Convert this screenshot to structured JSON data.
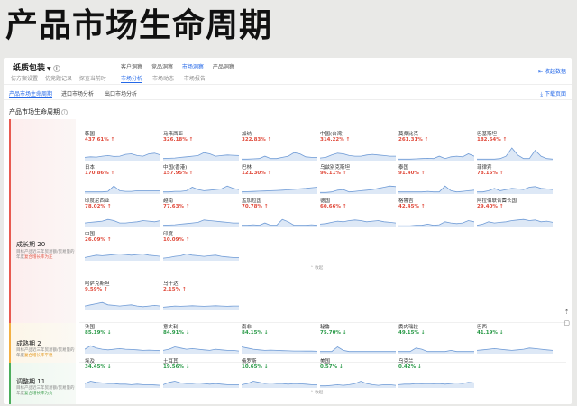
{
  "page_title": "产品市场生命周期",
  "header": {
    "product": "纸质包装",
    "sub_links": [
      "仿方案设置",
      "仿竞题记录",
      "探查当前时"
    ],
    "tabs_top": [
      {
        "label": "客户洞察",
        "active": false
      },
      {
        "label": "竞品洞察",
        "active": false
      },
      {
        "label": "市场洞察",
        "active": true
      },
      {
        "label": "产品洞察",
        "active": false
      }
    ],
    "tabs_sub": [
      {
        "label": "市场分析",
        "active": true
      },
      {
        "label": "市场动态",
        "active": false
      },
      {
        "label": "市场报告",
        "active": false
      }
    ],
    "collapse_label": "收起数据"
  },
  "tabs": [
    {
      "label": "产品市场生命周期",
      "active": true
    },
    {
      "label": "进口市场分析",
      "active": false
    },
    {
      "label": "出口市场分析",
      "active": false
    }
  ],
  "download_label": "下载页面",
  "section_title": "产品市场生命周期",
  "collapse_link_label": "收起",
  "colors": {
    "up": "#e04b3c",
    "down": "#2a9a48",
    "accent": "#2468e8",
    "spark": "#6f9bd6"
  },
  "stages": [
    {
      "name": "成长期",
      "count": "20",
      "desc_prefix": "目标产品近三年贸易额/贸易量的年度",
      "desc_em": "复合增长率为正",
      "items": [
        {
          "name": "韩国",
          "pct": "437.61%",
          "dir": "up",
          "spark": [
            0.2,
            0.25,
            0.22,
            0.3,
            0.35,
            0.28,
            0.3,
            0.45,
            0.5,
            0.35,
            0.3,
            0.5,
            0.55,
            0.4
          ]
        },
        {
          "name": "马来西亚",
          "pct": "326.18%",
          "dir": "up",
          "spark": [
            0.1,
            0.12,
            0.15,
            0.2,
            0.25,
            0.3,
            0.35,
            0.6,
            0.5,
            0.3,
            0.35,
            0.4,
            0.38,
            0.35
          ]
        },
        {
          "name": "加纳",
          "pct": "322.83%",
          "dir": "up",
          "spark": [
            0.05,
            0.05,
            0.08,
            0.1,
            0.3,
            0.1,
            0.1,
            0.2,
            0.3,
            0.6,
            0.5,
            0.25,
            0.2,
            0.2
          ]
        },
        {
          "name": "中国(台湾)",
          "pct": "314.22%",
          "dir": "up",
          "spark": [
            0.15,
            0.2,
            0.4,
            0.55,
            0.5,
            0.35,
            0.3,
            0.3,
            0.4,
            0.45,
            0.4,
            0.35,
            0.3,
            0.3
          ]
        },
        {
          "name": "莫桑比克",
          "pct": "261.31%",
          "dir": "up",
          "spark": [
            0.05,
            0.05,
            0.05,
            0.08,
            0.1,
            0.12,
            0.1,
            0.3,
            0.1,
            0.25,
            0.3,
            0.25,
            0.5,
            0.3
          ]
        },
        {
          "name": "巴基斯坦",
          "pct": "182.64%",
          "dir": "up",
          "spark": [
            0.05,
            0.05,
            0.05,
            0.05,
            0.1,
            0.3,
            1.0,
            0.4,
            0.1,
            0.1,
            0.8,
            0.3,
            0.1,
            0.05
          ]
        },
        {
          "name": "日本",
          "pct": "170.86%",
          "dir": "up",
          "spark": [
            0.1,
            0.1,
            0.1,
            0.1,
            0.15,
            0.6,
            0.2,
            0.15,
            0.15,
            0.2,
            0.2,
            0.2,
            0.2,
            0.2
          ]
        },
        {
          "name": "中国(香港)",
          "pct": "157.95%",
          "dir": "up",
          "spark": [
            0.1,
            0.1,
            0.15,
            0.15,
            0.2,
            0.5,
            0.3,
            0.2,
            0.25,
            0.3,
            0.35,
            0.6,
            0.4,
            0.3
          ]
        },
        {
          "name": "巴林",
          "pct": "121.30%",
          "dir": "up",
          "spark": [
            0.1,
            0.12,
            0.14,
            0.16,
            0.18,
            0.2,
            0.22,
            0.25,
            0.28,
            0.32,
            0.36,
            0.4,
            0.45,
            0.5
          ]
        },
        {
          "name": "乌兹别克斯坦",
          "pct": "96.11%",
          "dir": "up",
          "spark": [
            0.05,
            0.05,
            0.1,
            0.25,
            0.3,
            0.1,
            0.15,
            0.2,
            0.25,
            0.3,
            0.4,
            0.5,
            0.6,
            0.55
          ]
        },
        {
          "name": "泰国",
          "pct": "91.40%",
          "dir": "up",
          "spark": [
            0.1,
            0.1,
            0.1,
            0.1,
            0.1,
            0.15,
            0.1,
            0.1,
            0.6,
            0.2,
            0.1,
            0.15,
            0.2,
            0.25
          ]
        },
        {
          "name": "菲律宾",
          "pct": "78.15%",
          "dir": "up",
          "spark": [
            0.1,
            0.1,
            0.2,
            0.4,
            0.2,
            0.3,
            0.4,
            0.35,
            0.3,
            0.5,
            0.55,
            0.4,
            0.35,
            0.3
          ]
        },
        {
          "name": "印度尼西亚",
          "pct": "78.02%",
          "dir": "up",
          "spark": [
            0.3,
            0.35,
            0.4,
            0.45,
            0.6,
            0.5,
            0.3,
            0.3,
            0.35,
            0.4,
            0.5,
            0.45,
            0.4,
            0.5
          ]
        },
        {
          "name": "越南",
          "pct": "77.63%",
          "dir": "up",
          "spark": [
            0.1,
            0.12,
            0.15,
            0.2,
            0.25,
            0.3,
            0.35,
            0.55,
            0.5,
            0.45,
            0.4,
            0.35,
            0.3,
            0.3
          ]
        },
        {
          "name": "孟加拉国",
          "pct": "70.78%",
          "dir": "up",
          "spark": [
            0.1,
            0.1,
            0.15,
            0.1,
            0.3,
            0.1,
            0.1,
            0.6,
            0.4,
            0.1,
            0.1,
            0.1,
            0.15,
            0.1
          ]
        },
        {
          "name": "德国",
          "pct": "60.66%",
          "dir": "up",
          "spark": [
            0.2,
            0.25,
            0.35,
            0.45,
            0.4,
            0.5,
            0.55,
            0.5,
            0.4,
            0.45,
            0.5,
            0.4,
            0.35,
            0.3
          ]
        },
        {
          "name": "格鲁吉",
          "pct": "42.45%",
          "dir": "up",
          "spark": [
            0.05,
            0.05,
            0.05,
            0.1,
            0.1,
            0.2,
            0.1,
            0.15,
            0.4,
            0.3,
            0.25,
            0.3,
            0.5,
            0.4
          ]
        },
        {
          "name": "阿拉伯联合酋长国",
          "pct": "29.40%",
          "dir": "up",
          "spark": [
            0.1,
            0.2,
            0.4,
            0.3,
            0.35,
            0.4,
            0.5,
            0.55,
            0.6,
            0.5,
            0.55,
            0.4,
            0.45,
            0.35
          ]
        },
        {
          "name": "中国",
          "pct": "26.09%",
          "dir": "up",
          "spark": [
            0.2,
            0.3,
            0.4,
            0.35,
            0.4,
            0.45,
            0.5,
            0.45,
            0.4,
            0.45,
            0.5,
            0.4,
            0.35,
            0.3
          ]
        },
        {
          "name": "印度",
          "pct": "10.09%",
          "dir": "up",
          "spark": [
            0.15,
            0.2,
            0.3,
            0.35,
            0.5,
            0.4,
            0.35,
            0.3,
            0.35,
            0.4,
            0.3,
            0.25,
            0.2,
            0.2
          ]
        }
      ]
    },
    {
      "name": "成熟期",
      "count": "2",
      "desc_prefix": "目标产品近三年贸易额/贸易量的年度",
      "desc_em": "复合增长率平稳",
      "items": [
        {
          "name": "哈萨克斯坦",
          "pct": "9.59%",
          "dir": "up",
          "spark": [
            0.3,
            0.4,
            0.5,
            0.6,
            0.4,
            0.35,
            0.3,
            0.35,
            0.4,
            0.3,
            0.25,
            0.3,
            0.35,
            0.3
          ]
        },
        {
          "name": "乌干达",
          "pct": "2.15%",
          "dir": "up",
          "spark": [
            0.2,
            0.25,
            0.3,
            0.28,
            0.3,
            0.32,
            0.3,
            0.28,
            0.3,
            0.32,
            0.3,
            0.28,
            0.3,
            0.3
          ]
        }
      ]
    },
    {
      "name": "调整期",
      "count": "11",
      "desc_prefix": "目标产品近三年贸易额/贸易量的年度",
      "desc_em": "复合增长率为负",
      "items": [
        {
          "name": "法国",
          "pct": "85.19%",
          "dir": "down",
          "spark": [
            0.3,
            0.6,
            0.4,
            0.3,
            0.25,
            0.3,
            0.35,
            0.3,
            0.28,
            0.25,
            0.2,
            0.22,
            0.2,
            0.18
          ]
        },
        {
          "name": "意大利",
          "pct": "84.91%",
          "dir": "down",
          "spark": [
            0.2,
            0.3,
            0.5,
            0.4,
            0.3,
            0.35,
            0.3,
            0.25,
            0.2,
            0.3,
            0.25,
            0.2,
            0.2,
            0.15
          ]
        },
        {
          "name": "南非",
          "pct": "84.15%",
          "dir": "down",
          "spark": [
            0.5,
            0.4,
            0.3,
            0.25,
            0.2,
            0.22,
            0.2,
            0.18,
            0.16,
            0.15,
            0.15,
            0.14,
            0.14,
            0.12
          ]
        },
        {
          "name": "秘鲁",
          "pct": "75.70%",
          "dir": "down",
          "spark": [
            0.1,
            0.1,
            0.1,
            0.5,
            0.2,
            0.1,
            0.1,
            0.1,
            0.1,
            0.1,
            0.1,
            0.1,
            0.1,
            0.1
          ]
        },
        {
          "name": "委内瑞拉",
          "pct": "49.15%",
          "dir": "down",
          "spark": [
            0.1,
            0.1,
            0.1,
            0.4,
            0.3,
            0.1,
            0.1,
            0.1,
            0.1,
            0.2,
            0.1,
            0.1,
            0.1,
            0.1
          ]
        },
        {
          "name": "巴西",
          "pct": "41.19%",
          "dir": "down",
          "spark": [
            0.2,
            0.25,
            0.3,
            0.35,
            0.3,
            0.25,
            0.2,
            0.25,
            0.3,
            0.4,
            0.35,
            0.3,
            0.25,
            0.2
          ]
        },
        {
          "name": "埃及",
          "pct": "34.45%",
          "dir": "down",
          "spark": [
            0.3,
            0.5,
            0.4,
            0.35,
            0.3,
            0.3,
            0.25,
            0.25,
            0.2,
            0.25,
            0.2,
            0.2,
            0.18,
            0.15
          ]
        },
        {
          "name": "土耳其",
          "pct": "19.56%",
          "dir": "down",
          "spark": [
            0.2,
            0.4,
            0.5,
            0.35,
            0.3,
            0.3,
            0.35,
            0.3,
            0.25,
            0.3,
            0.25,
            0.2,
            0.2,
            0.2
          ]
        },
        {
          "name": "俄罗斯",
          "pct": "10.65%",
          "dir": "down",
          "spark": [
            0.2,
            0.3,
            0.5,
            0.4,
            0.3,
            0.35,
            0.3,
            0.3,
            0.25,
            0.3,
            0.28,
            0.25,
            0.2,
            0.2
          ]
        },
        {
          "name": "美国",
          "pct": "0.57%",
          "dir": "down",
          "spark": [
            0.1,
            0.1,
            0.15,
            0.2,
            0.15,
            0.2,
            0.3,
            0.5,
            0.3,
            0.2,
            0.15,
            0.2,
            0.2,
            0.15
          ]
        },
        {
          "name": "乌克兰",
          "pct": "0.42%",
          "dir": "down",
          "spark": [
            0.2,
            0.25,
            0.25,
            0.3,
            0.28,
            0.3,
            0.28,
            0.3,
            0.25,
            0.3,
            0.35,
            0.3,
            0.4,
            0.35
          ]
        }
      ]
    }
  ]
}
